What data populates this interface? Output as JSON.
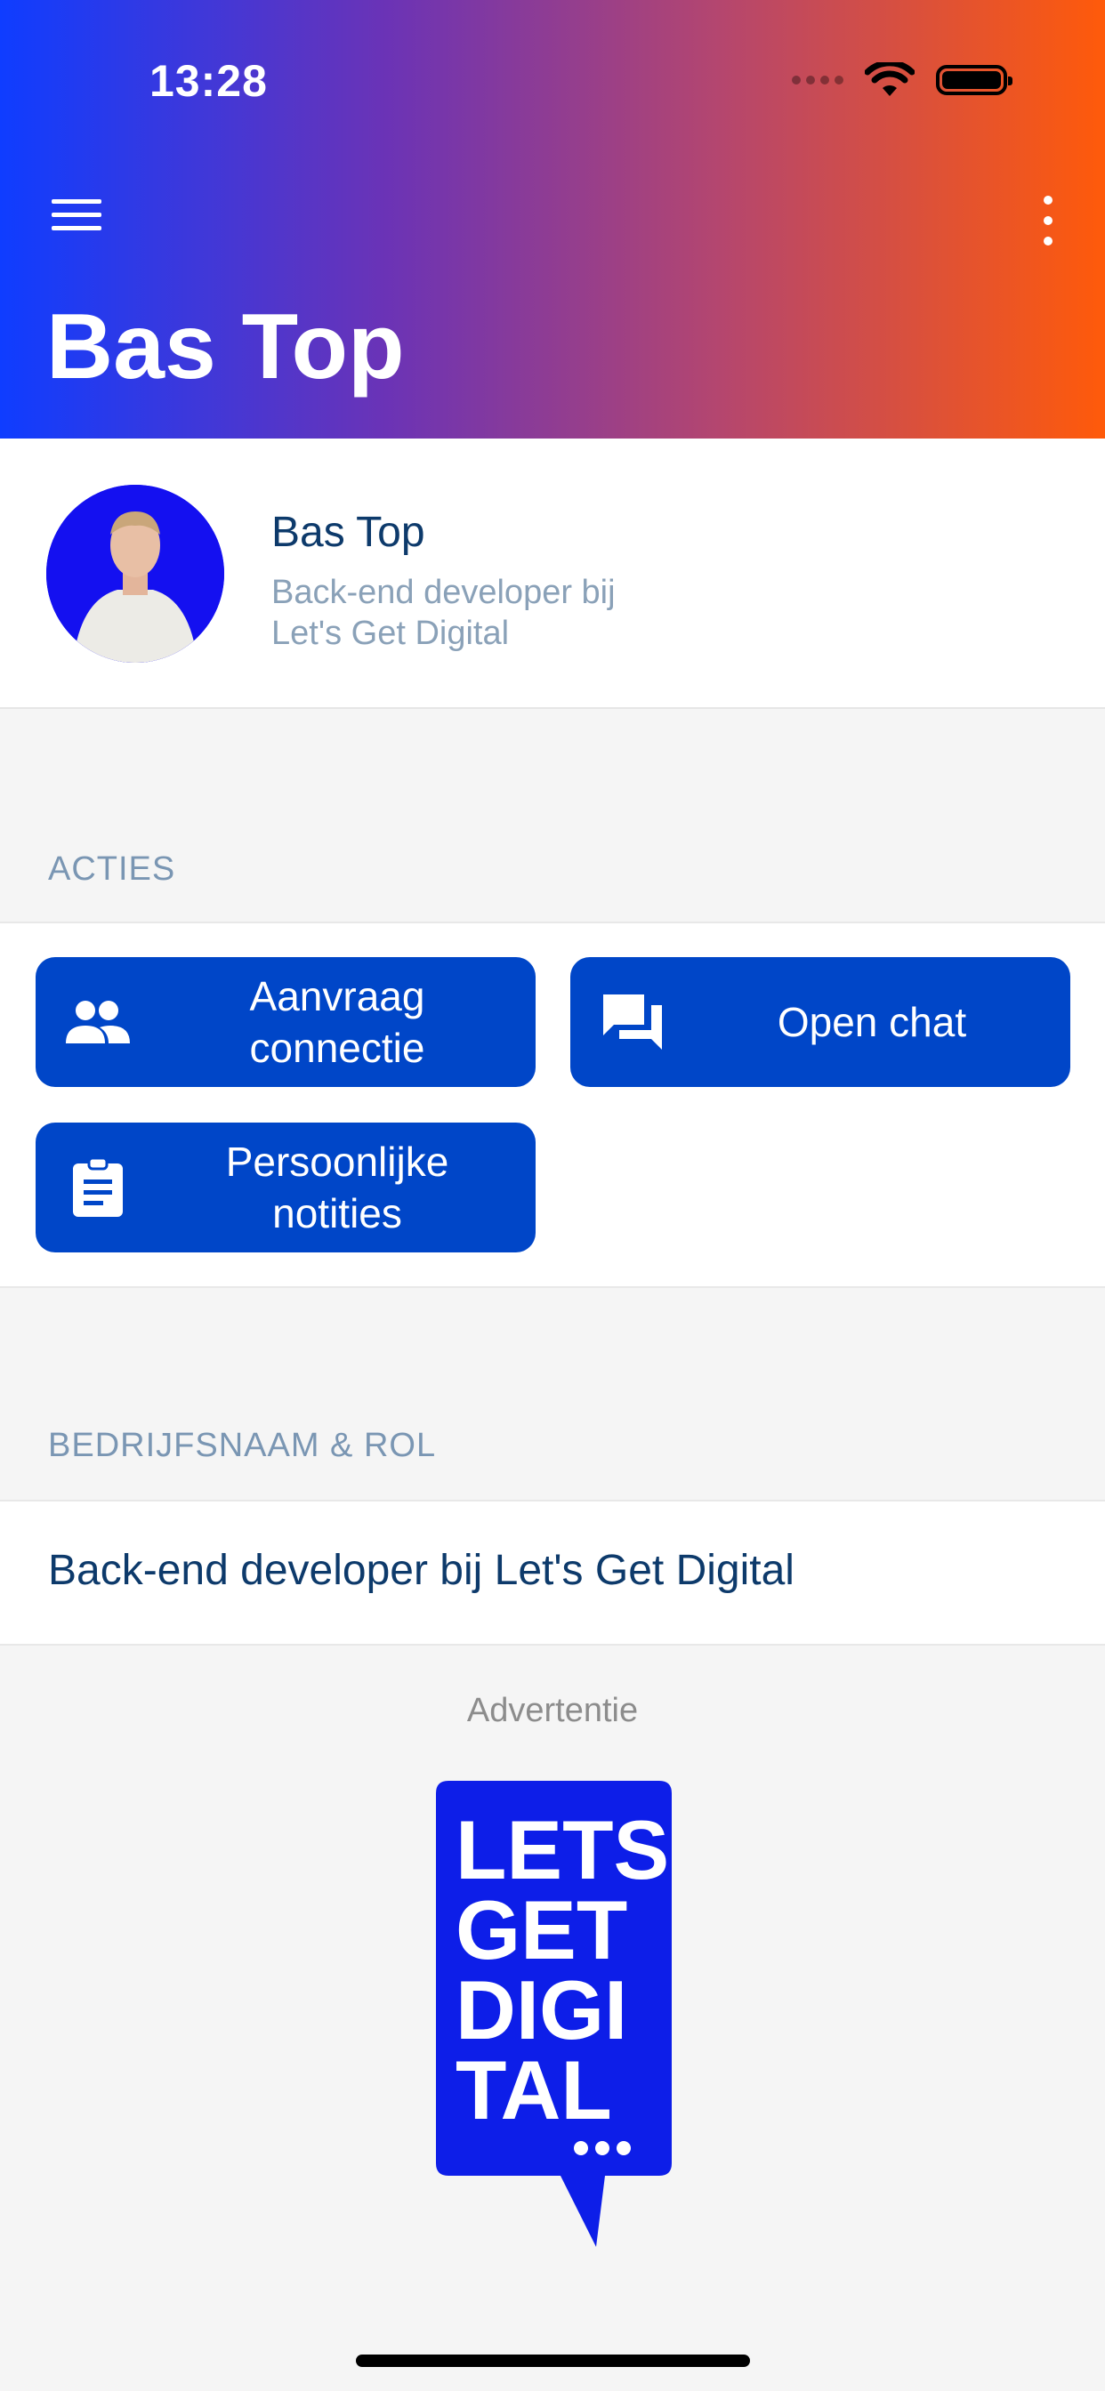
{
  "status_bar": {
    "time": "13:28"
  },
  "header": {
    "title": "Bas Top"
  },
  "profile": {
    "name": "Bas Top",
    "subtitle_line1": "Back-end developer bij",
    "subtitle_line2": "Let's Get Digital"
  },
  "sections": {
    "actions_label": "ACTIES",
    "company_label": "BEDRIJFSNAAM & ROL"
  },
  "actions": {
    "connect_line1": "Aanvraag",
    "connect_line2": "connectie",
    "chat": "Open chat",
    "notes_line1": "Persoonlijke",
    "notes_line2": "notities"
  },
  "company_role": "Back-end developer bij Let's Get Digital",
  "ad": {
    "label": "Advertentie",
    "logo_lines": [
      "LETS",
      "GET",
      "DIGI",
      "TAL"
    ]
  },
  "colors": {
    "brand_blue": "#0046c8",
    "gradient_start": "#0f3dff",
    "gradient_end": "#ff5a0a",
    "text_navy": "#0d3a6b",
    "section_label": "#7a96b3"
  },
  "icons": {
    "menu": "hamburger-menu-icon",
    "more": "more-vertical-icon",
    "connect": "people-icon",
    "chat": "forum-icon",
    "notes": "clipboard-icon"
  }
}
